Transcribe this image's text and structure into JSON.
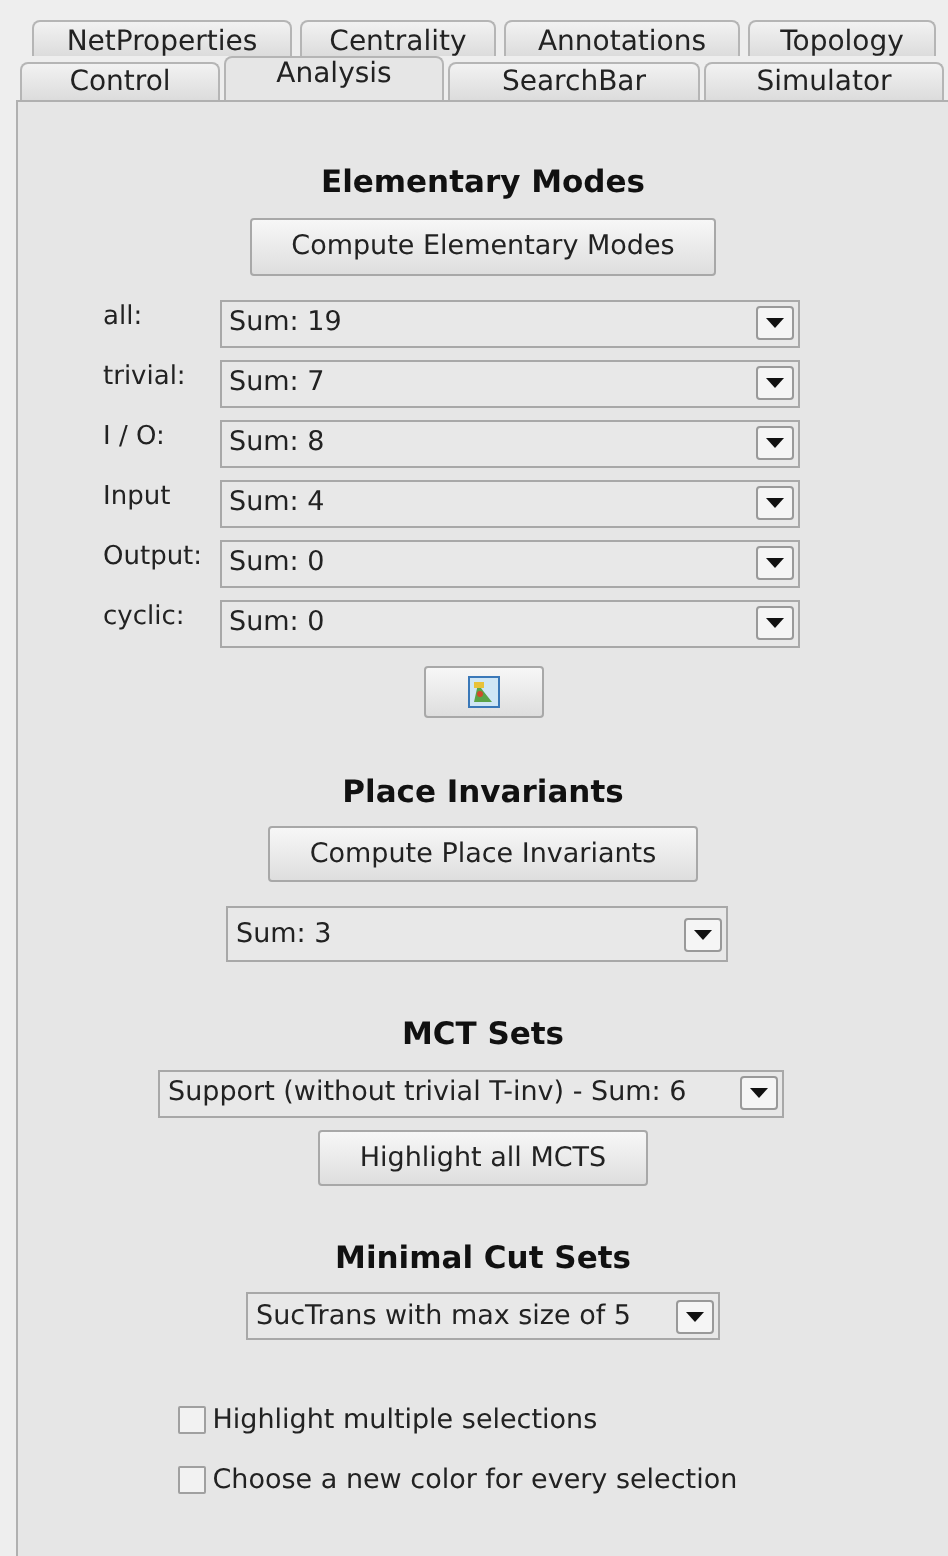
{
  "tab_rows": [
    {
      "tabs": [
        {
          "label": "NetProperties",
          "selected": false
        },
        {
          "label": "Centrality",
          "selected": false
        },
        {
          "label": "Annotations",
          "selected": false
        },
        {
          "label": "Topology",
          "selected": false
        }
      ]
    },
    {
      "tabs": [
        {
          "label": "Control",
          "selected": false
        },
        {
          "label": "Analysis",
          "selected": true
        },
        {
          "label": "SearchBar",
          "selected": false
        },
        {
          "label": "Simulator",
          "selected": false
        }
      ]
    }
  ],
  "elementary_modes": {
    "title": "Elementary Modes",
    "button": "Compute Elementary Modes",
    "rows": [
      {
        "label": "all:",
        "value": "Sum: 19"
      },
      {
        "label": "trivial:",
        "value": "Sum: 7"
      },
      {
        "label": "I / O:",
        "value": "Sum: 8"
      },
      {
        "label": "Input",
        "value": "Sum: 4"
      },
      {
        "label": "Output:",
        "value": "Sum: 0"
      },
      {
        "label": "cyclic:",
        "value": "Sum: 0"
      }
    ]
  },
  "place_invariants": {
    "title": "Place Invariants",
    "button": "Compute Place Invariants",
    "dropdown": "Sum: 3"
  },
  "mct_sets": {
    "title": "MCT Sets",
    "dropdown": "Support (without trivial T-inv) - Sum: 6",
    "button": "Highlight all MCTS"
  },
  "minimal_cut_sets": {
    "title": "Minimal Cut Sets",
    "dropdown": "SucTrans with max size of 5"
  },
  "options": [
    {
      "label": "Highlight multiple selections",
      "checked": false
    },
    {
      "label": "Choose a new color for every selection",
      "checked": false
    }
  ]
}
